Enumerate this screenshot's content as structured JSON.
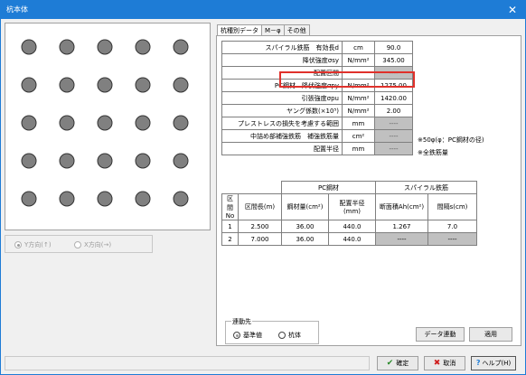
{
  "window": {
    "title": "杭本体",
    "close_glyph": "✕"
  },
  "direction": {
    "y_label": "Y方向(↑)",
    "x_label": "X方向(→)"
  },
  "tabs": [
    "杭種別データ",
    "M－φ",
    "その他"
  ],
  "params": [
    {
      "label": "スパイラル鉄筋　有効長d",
      "unit": "cm",
      "value": "90.0",
      "gray": false
    },
    {
      "label": "降伏強度σsy",
      "unit": "N/mm²",
      "value": "345.00",
      "gray": false
    },
    {
      "label": "配置区間",
      "unit": "－",
      "value": "----",
      "gray": true
    },
    {
      "label": "PC鋼材　降伏強度σpy",
      "unit": "N/mm²",
      "value": "1275.00",
      "gray": false
    },
    {
      "label": "引張強度σpu",
      "unit": "N/mm²",
      "value": "1420.00",
      "gray": false
    },
    {
      "label": "ヤング係数(×10⁵)",
      "unit": "N/mm²",
      "value": "2.00",
      "gray": false
    },
    {
      "label": "プレストレスの損失を考慮する範囲",
      "unit": "mm",
      "value": "----",
      "gray": true
    },
    {
      "label": "中詰め部補強鉄筋　補強鉄筋量",
      "unit": "cm²",
      "value": "----",
      "gray": true
    },
    {
      "label": "配置半径",
      "unit": "mm",
      "value": "----",
      "gray": true
    }
  ],
  "notes": {
    "range_note": "※50φ(φ：PC鋼材の径)",
    "rebar_note": "※全鉄筋量"
  },
  "section_table": {
    "group_pc": "PC鋼材",
    "group_spiral": "スパイラル鉄筋",
    "headers": [
      "区間No",
      "区間長(m)",
      "鋼材量(cm²)",
      "配置半径(mm)",
      "断面積Ah(cm²)",
      "間隔s(cm)"
    ],
    "rows": [
      {
        "no": "1",
        "length": "2.500",
        "steel": "36.00",
        "radius": "440.0",
        "area": "1.267",
        "spacing": "7.0",
        "gray": false
      },
      {
        "no": "2",
        "length": "7.000",
        "steel": "36.00",
        "radius": "440.0",
        "area": "----",
        "spacing": "----",
        "gray": true
      }
    ]
  },
  "link": {
    "legend": "連動先",
    "opt_base": "基準値",
    "opt_pile": "杭体"
  },
  "buttons": {
    "data_link": "データ連動",
    "apply": "適用",
    "ok": "確定",
    "cancel": "取消",
    "help": "ヘルプ(H)"
  },
  "colors": {
    "accent": "#1e7cd6",
    "highlight": "#e0312b",
    "rebar": "#808080",
    "check": "#2a8a2a",
    "cross": "#d02020"
  }
}
